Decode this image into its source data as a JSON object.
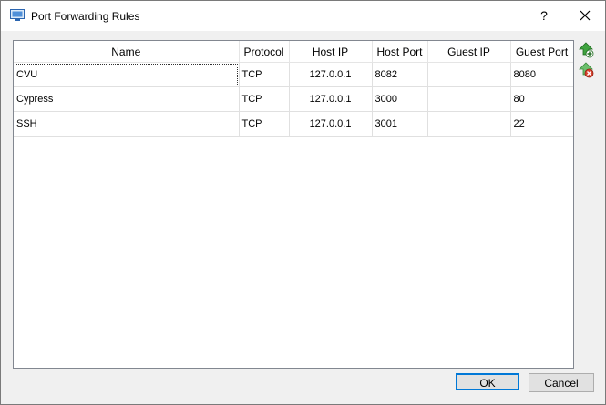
{
  "window": {
    "title": "Port Forwarding Rules",
    "help_label": "?",
    "close_icon": "close-icon",
    "app_icon": "virtualbox-icon"
  },
  "table": {
    "columns": [
      "Name",
      "Protocol",
      "Host IP",
      "Host Port",
      "Guest IP",
      "Guest Port"
    ],
    "rows": [
      {
        "name": "CVU",
        "protocol": "TCP",
        "host_ip": "127.0.0.1",
        "host_port": "8082",
        "guest_ip": "",
        "guest_port": "8080"
      },
      {
        "name": "Cypress",
        "protocol": "TCP",
        "host_ip": "127.0.0.1",
        "host_port": "3000",
        "guest_ip": "",
        "guest_port": "80"
      },
      {
        "name": "SSH",
        "protocol": "TCP",
        "host_ip": "127.0.0.1",
        "host_port": "3001",
        "guest_ip": "",
        "guest_port": "22"
      }
    ]
  },
  "side_buttons": {
    "add_icon": "add-rule-icon",
    "remove_icon": "remove-rule-icon"
  },
  "buttons": {
    "ok": "OK",
    "cancel": "Cancel"
  },
  "colors": {
    "accent": "#0078d7",
    "add_green": "#3fa33f",
    "remove_red": "#d9432f"
  }
}
